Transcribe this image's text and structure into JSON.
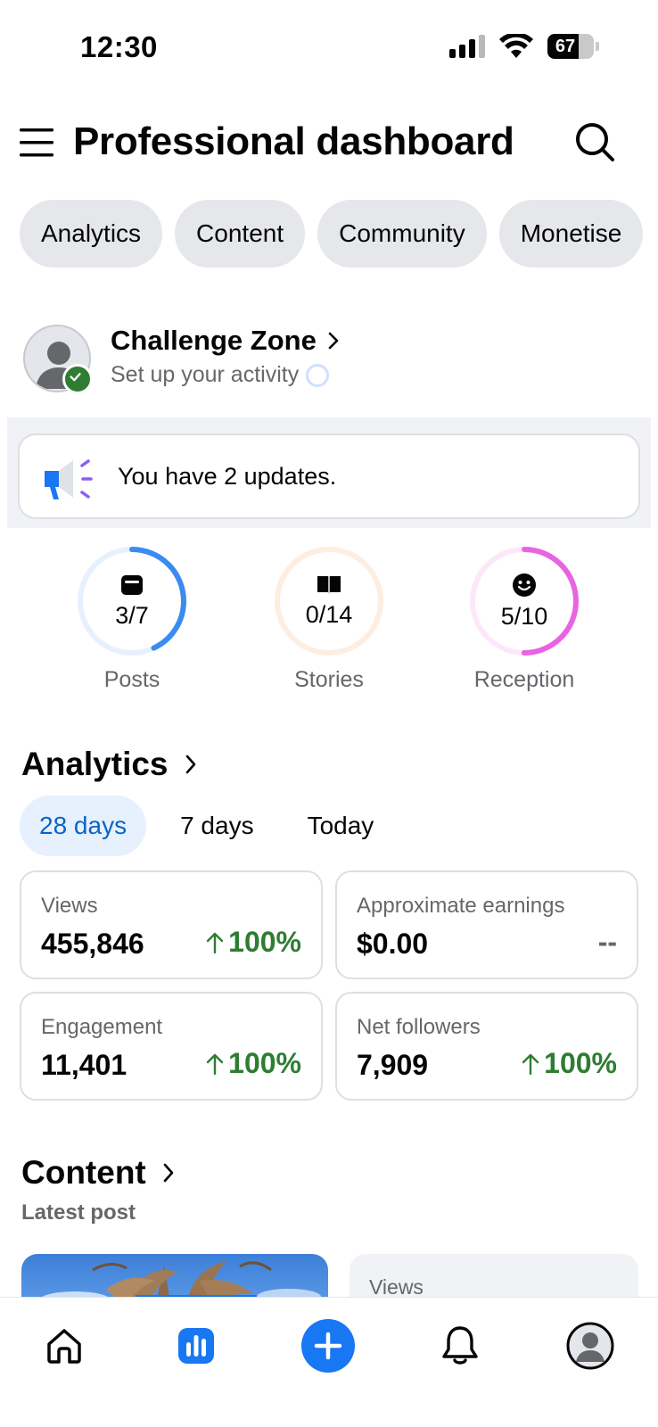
{
  "status_bar": {
    "time": "12:30",
    "battery": "67"
  },
  "header": {
    "title": "Professional dashboard"
  },
  "tabs": [
    {
      "label": "Analytics"
    },
    {
      "label": "Content"
    },
    {
      "label": "Community"
    },
    {
      "label": "Monetise"
    }
  ],
  "challenge_zone": {
    "title": "Challenge Zone",
    "subtitle": "Set up your activity"
  },
  "updates": {
    "text": "You have 2 updates."
  },
  "progress": [
    {
      "label": "Posts",
      "count": "3/7",
      "fraction": 0.43,
      "color": "#3b8bf0",
      "track": "#e7f1fd",
      "icon": "post-icon"
    },
    {
      "label": "Stories",
      "count": "0/14",
      "fraction": 0.0,
      "color": "#f7a35c",
      "track": "#fdeee2",
      "icon": "book-icon"
    },
    {
      "label": "Reception",
      "count": "5/10",
      "fraction": 0.5,
      "color": "#e964e0",
      "track": "#fde8fb",
      "icon": "smiley-icon"
    }
  ],
  "analytics": {
    "title": "Analytics",
    "periods": [
      {
        "label": "28 days",
        "active": true
      },
      {
        "label": "7 days",
        "active": false
      },
      {
        "label": "Today",
        "active": false
      }
    ],
    "stats": [
      {
        "label": "Views",
        "value": "455,846",
        "change": "100%",
        "trend": "up"
      },
      {
        "label": "Approximate earnings",
        "value": "$0.00",
        "change": "--",
        "trend": "none"
      },
      {
        "label": "Engagement",
        "value": "11,401",
        "change": "100%",
        "trend": "up"
      },
      {
        "label": "Net followers",
        "value": "7,909",
        "change": "100%",
        "trend": "up"
      }
    ]
  },
  "content": {
    "title": "Content",
    "subtitle": "Latest post",
    "views_label": "Views"
  },
  "bottom_nav": [
    {
      "name": "home-icon"
    },
    {
      "name": "dashboard-icon",
      "active": true
    },
    {
      "name": "create-icon"
    },
    {
      "name": "bell-icon"
    },
    {
      "name": "profile-icon"
    }
  ],
  "colors": {
    "accent": "#1877f2",
    "positive": "#2e7d32",
    "muted": "#65676b",
    "pill": "#e5e7eb"
  }
}
